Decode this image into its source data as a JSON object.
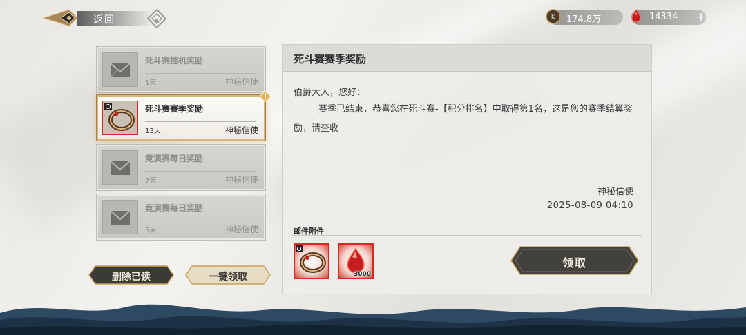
{
  "topbar": {
    "back_label": "返回",
    "coins": "174.8万",
    "gems": "14334",
    "plus": "+"
  },
  "mail_list": [
    {
      "title": "死斗赛挂机奖励",
      "days": "1天",
      "sender": "神秘信使",
      "icon": "envelope-icon",
      "selected": false
    },
    {
      "title": "死斗赛赛季奖励",
      "days": "13天",
      "sender": "神秘信使",
      "icon": "bracelet-icon",
      "selected": true
    },
    {
      "title": "竞演赛每日奖励",
      "days": "7天",
      "sender": "神秘信使",
      "icon": "envelope-icon",
      "selected": false
    },
    {
      "title": "竞演赛每日奖励",
      "days": "5天",
      "sender": "神秘信使",
      "icon": "envelope-icon",
      "selected": false
    }
  ],
  "buttons": {
    "delete_read": "删除已读",
    "claim_all": "一键领取",
    "claim": "领取"
  },
  "detail": {
    "title": "死斗赛赛季奖励",
    "greeting": "伯爵大人，您好：",
    "body": "赛季已结束，恭喜您在死斗赛-【积分排名】中取得第1名，这是您的赛季结算奖励，请查收",
    "sender": "神秘信使",
    "datetime": "2025-08-09  04:10",
    "attachments_label": "邮件附件",
    "attachments": [
      {
        "icon": "bracelet-icon",
        "count": ""
      },
      {
        "icon": "red-gem-icon",
        "count": "3000"
      }
    ]
  },
  "colors": {
    "accent_gold": "#c9a15c",
    "alert_red": "#d42a24",
    "dark_button": "#3b3a36"
  }
}
